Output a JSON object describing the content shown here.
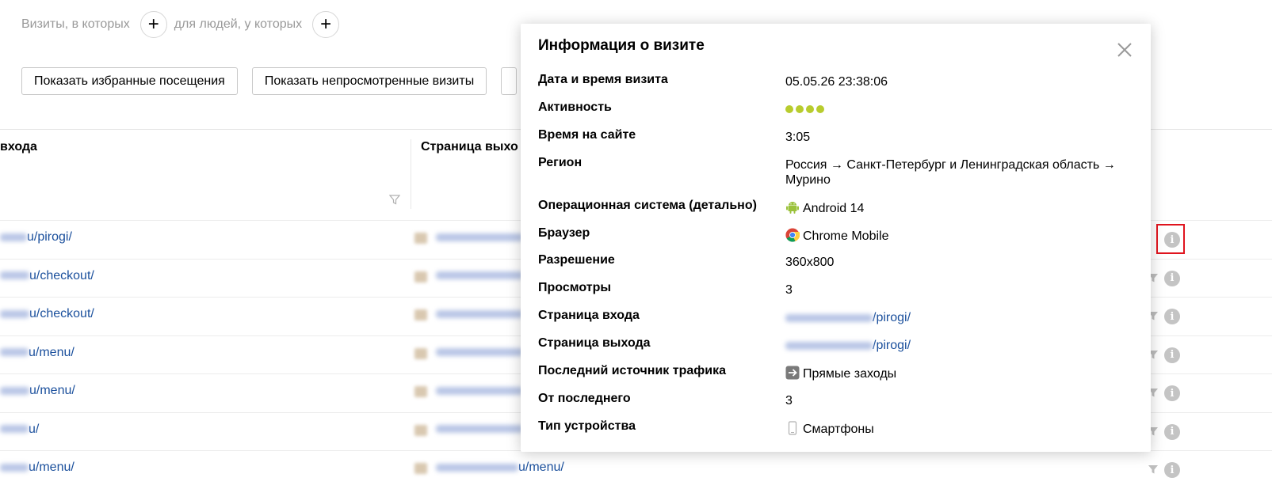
{
  "segment": {
    "visits_label": "Визиты, в которых",
    "people_label": "для людей, у которых",
    "plus": "+"
  },
  "filters": {
    "favorites": "Показать избранные посещения",
    "unviewed": "Показать непросмотренные визиты"
  },
  "table": {
    "entry_header": "входа",
    "exit_header": "Страница выхо",
    "rows": [
      {
        "entry": "u/pirogi/",
        "exit": ""
      },
      {
        "entry": "u/checkout/",
        "exit": ""
      },
      {
        "entry": "u/checkout/",
        "exit": ""
      },
      {
        "entry": "u/menu/",
        "exit": ""
      },
      {
        "entry": "u/menu/",
        "exit": ""
      },
      {
        "entry": "u/",
        "exit": ""
      },
      {
        "entry": "u/menu/",
        "exit": "u/menu/"
      }
    ]
  },
  "modal": {
    "title": "Информация о визите",
    "rows": [
      {
        "label": "Дата и время визита",
        "value": "05.05.26 23:38:06"
      },
      {
        "label": "Активность",
        "value": "",
        "level": 4
      },
      {
        "label": "Время на сайте",
        "value": "3:05"
      },
      {
        "label": "Регион",
        "value": "Россия → Санкт-Петербург и Ленинградская область → Мурино"
      },
      {
        "label": "Операционная система (детально)",
        "value": "Android 14",
        "icon": "android-icon"
      },
      {
        "label": "Браузер",
        "value": "Chrome Mobile",
        "icon": "chrome-icon"
      },
      {
        "label": "Разрешение",
        "value": "360x800"
      },
      {
        "label": "Просмотры",
        "value": "3"
      },
      {
        "label": "Страница входа",
        "value": "/pirogi/",
        "link": true
      },
      {
        "label": "Страница выхода",
        "value": "/pirogi/",
        "link": true
      },
      {
        "label": "Последний источник трафика",
        "value": "Прямые заходы",
        "icon": "direct-traffic-icon"
      },
      {
        "label": "От последнего",
        "value": "3"
      },
      {
        "label": "Тип устройства",
        "value": "Смартфоны",
        "icon": "smartphone-icon"
      }
    ]
  },
  "colors": {
    "link": "#1a4f9c",
    "activity": "#b8cc2e",
    "highlight": "#e0141e"
  }
}
